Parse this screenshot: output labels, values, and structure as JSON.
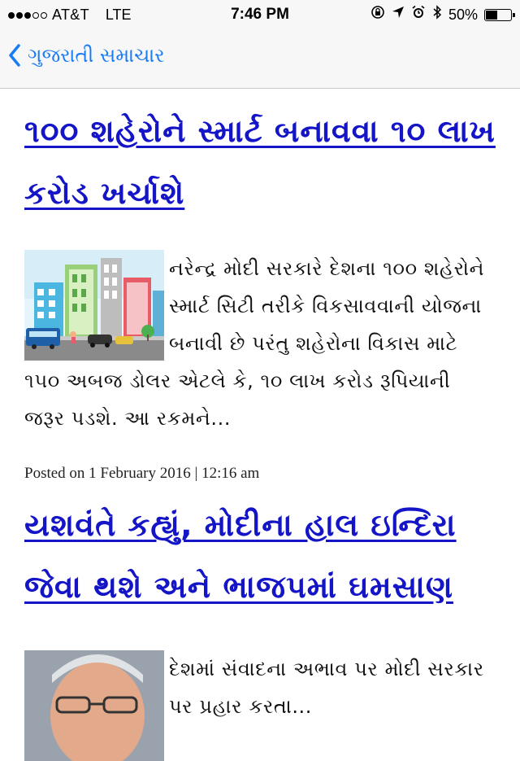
{
  "status_bar": {
    "carrier": "AT&T",
    "network": "LTE",
    "time": "7:46 PM",
    "battery": "50%",
    "battery_level": 0.5,
    "signal_strength": 3,
    "icons": [
      "rotation-lock-icon",
      "location-icon",
      "alarm-icon",
      "bluetooth-icon",
      "battery-icon"
    ]
  },
  "nav": {
    "back_label": "ગુજરાતી સમાચાર",
    "accent_color": "#1a7cf5"
  },
  "articles": [
    {
      "headline": "૧૦૦ શહેરોને સ્માર્ટ બનાવવા ૧૦ લાખ કરોડ ખર્ચાશે",
      "summary": "નરેન્દ્ર મોદી સરકારે દેશના ૧૦૦ શહેરોને સ્માર્ટ સિટી તરીકે વિકસાવવાની યોજના બનાવી છે પરંતુ શહેરોના વિકાસ માટે ૧૫૦ અબજ ડોલર એટલે કે, ૧૦ લાખ કરોડ રૂપિયાની જરૂર પડશે. આ રકમને...",
      "meta": "Posted on 1 February 2016 | 12:16 am",
      "thumbnail": "city-illustration"
    },
    {
      "headline": "યશવંતે કહ્યું, મોદીના હાલ ઇન્દિરા જેવા થશે અને ભાજપમાં ઘમસાણ",
      "summary": "દેશમાં સંવાદના અભાવ પર મોદી સરકાર પર પ્રહાર કરતા...",
      "thumbnail": "portrait-photo"
    }
  ],
  "link_color": "#1515c8"
}
